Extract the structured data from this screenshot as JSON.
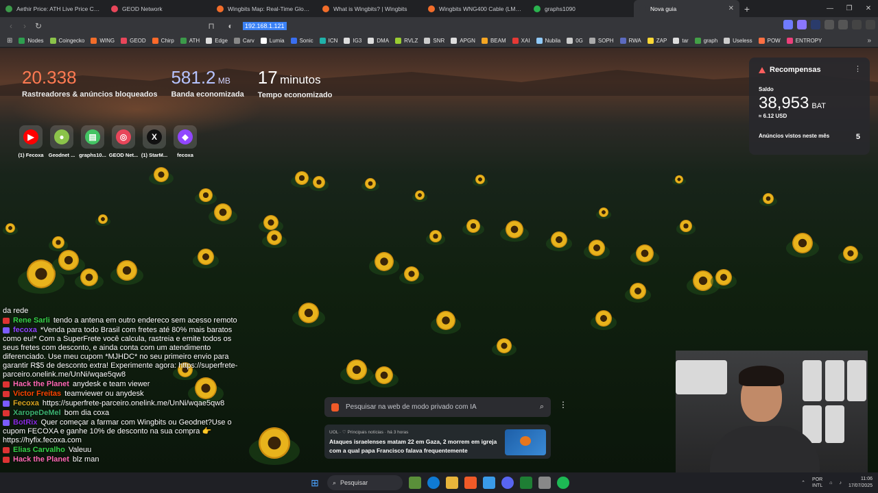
{
  "tabs": [
    {
      "title": "Aethir Price: ATH Live Price Chart, Ma",
      "color": "#3c9a4a"
    },
    {
      "title": "GEOD Network",
      "color": "#e8465a"
    },
    {
      "title": "Wingbits Map: Real-Time Global Flig",
      "color": "#f26d2a"
    },
    {
      "title": "What is Wingbits? | Wingbits",
      "color": "#f26d2a"
    },
    {
      "title": "Wingbits WNG400 Cable (LMR®-400",
      "color": "#f26d2a"
    },
    {
      "title": "graphs1090",
      "color": "#2bb34f"
    },
    {
      "title": "Nova guia",
      "color": "#35363a",
      "active": true
    }
  ],
  "address": {
    "url": "192.168.1.121"
  },
  "bookmarks": [
    {
      "label": "Nodes",
      "color": "#2e9e4f"
    },
    {
      "label": "Coingecko",
      "color": "#8bc34a"
    },
    {
      "label": "WING",
      "color": "#f26d2a"
    },
    {
      "label": "GEOD",
      "color": "#e8465a"
    },
    {
      "label": "Chirp",
      "color": "#ff6a2a"
    },
    {
      "label": "ATH",
      "color": "#3c9a4a"
    },
    {
      "label": "Edge",
      "color": "#dddddd"
    },
    {
      "label": "Carv",
      "color": "#888888"
    },
    {
      "label": "Lumia",
      "color": "#ffffff"
    },
    {
      "label": "Sonic",
      "color": "#3a6ff0"
    },
    {
      "label": "ICN",
      "color": "#20b2aa"
    },
    {
      "label": "IG3",
      "color": "#dddddd"
    },
    {
      "label": "DMA",
      "color": "#dddddd"
    },
    {
      "label": "RVLZ",
      "color": "#9acd32"
    },
    {
      "label": "SNR",
      "color": "#cccccc"
    },
    {
      "label": "APGN",
      "color": "#dddddd"
    },
    {
      "label": "BEAM",
      "color": "#f5a623"
    },
    {
      "label": "XAI",
      "color": "#e53935"
    },
    {
      "label": "Nubila",
      "color": "#90caf9"
    },
    {
      "label": "0G",
      "color": "#cccccc"
    },
    {
      "label": "SOPH",
      "color": "#aaaaaa"
    },
    {
      "label": "RWA",
      "color": "#5c6bc0"
    },
    {
      "label": "ZAP",
      "color": "#fdd835"
    },
    {
      "label": "tar",
      "color": "#dddddd"
    },
    {
      "label": "graph",
      "color": "#43a047"
    },
    {
      "label": "Useless",
      "color": "#cccccc"
    },
    {
      "label": "POW",
      "color": "#ff7043"
    },
    {
      "label": "ENTROPY",
      "color": "#ec407a"
    }
  ],
  "stats": {
    "trackers": {
      "value": "20.338",
      "label": "Rastreadores & anúncios bloqueados"
    },
    "bandwidth": {
      "value": "581.2",
      "unit": "MB",
      "label": "Banda economizada"
    },
    "time": {
      "value": "17",
      "unit": "minutos",
      "label": "Tempo economizado"
    }
  },
  "shortcuts": [
    {
      "label": "(1) Fecoxa",
      "glyph": "▶",
      "color": "#ff0000"
    },
    {
      "label": "Geodnet ...",
      "glyph": "●",
      "color": "#8bc34a"
    },
    {
      "label": "graphs10...",
      "glyph": "▤",
      "color": "#43c463"
    },
    {
      "label": "GEOD Net...",
      "glyph": "◎",
      "color": "#e8465a"
    },
    {
      "label": "(1) StarM...",
      "glyph": "X",
      "color": "#111111"
    },
    {
      "label": "fecoxa",
      "glyph": "◆",
      "color": "#9146ff"
    }
  ],
  "rewards": {
    "title": "Recompensas",
    "saldo_label": "Saldo",
    "balance": "38,953",
    "currency": "BAT",
    "usd": "≈ 6.12 USD",
    "ads_label": "Anúncios vistos neste mês",
    "ads_count": "5"
  },
  "chat": [
    {
      "user": "",
      "color": "#ffffff",
      "text": "da rede"
    },
    {
      "user": "Rene Sarli",
      "color": "#37d34a",
      "text": "tendo a antena em outro endereco sem acesso remoto"
    },
    {
      "user": "fecoxa",
      "color": "#9146ff",
      "text": "*Venda para todo Brasil com fretes até 80% mais baratos como eu!* Com a SuperFrete você calcula, rastreia e emite todos os seus fretes com desconto, e ainda conta com um atendimento diferenciado. Use meu cupom *MJHDC* no seu primeiro envio para garantir R$5 de desconto extra! Experimente agora: https://superfrete-parceiro.onelink.me/UnNi/wqae5qw8"
    },
    {
      "user": "Hack the Planet",
      "color": "#ff69b4",
      "text": "anydesk e team viewer"
    },
    {
      "user": "Victor Freitas",
      "color": "#ff4500",
      "text": "teamviewer ou anydesk"
    },
    {
      "user": "Fecoxa",
      "color": "#daa520",
      "text": "https://superfrete-parceiro.onelink.me/UnNi/wqae5qw8"
    },
    {
      "user": "XaropeDeMel",
      "color": "#3cb371",
      "text": "bom dia coxa"
    },
    {
      "user": "BotRix",
      "color": "#8a2be2",
      "text": "Quer começar a farmar com Wingbits ou Geodnet?Use o cupom FECOXA e ganhe 10% de desconto na sua compra 👉 https://hyfix.fecoxa.com"
    },
    {
      "user": "Elias Carvalho",
      "color": "#37d34a",
      "text": "Valeuu"
    },
    {
      "user": "Hack the Planet",
      "color": "#ff69b4",
      "text": "blz man"
    }
  ],
  "search": {
    "placeholder": "Pesquisar na web de modo privado com IA"
  },
  "news": {
    "source": "UOL · ♡ Principais notícias · há 3 horas",
    "headline": "Ataques israelenses matam 22 em Gaza, 2 morrem em igreja com a qual papa Francisco falava frequentemente"
  },
  "taskbar": {
    "search_label": "Pesquisar",
    "lang_top": "POR",
    "lang_bottom": "INTL",
    "time": "11:06",
    "date": "17/07/2025"
  }
}
